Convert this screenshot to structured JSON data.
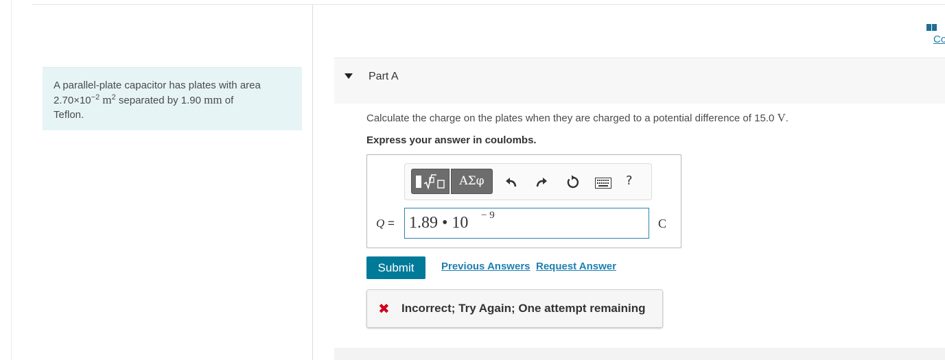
{
  "problem": {
    "line1": "A parallel-plate capacitor has plates with area",
    "area_value": "2.70×10",
    "area_exponent": "−2",
    "area_unit": "m",
    "area_unit_power": "2",
    "mid_text": " separated by 1.90 ",
    "separation_unit": "mm",
    "tail_text": " of",
    "line3": "Teflon."
  },
  "coaching": {
    "link_label": "Co",
    "icon": "book-icon"
  },
  "part": {
    "title": "Part A",
    "toggle_icon": "triangle-down-icon"
  },
  "question": {
    "text": "Calculate the charge on the plates when they are charged to a potential difference of 15.0 ",
    "unit": "V",
    "end": ".",
    "instruction": "Express your answer in coulombs."
  },
  "toolbar": {
    "greek_label": "ΑΣφ",
    "help_label": "?",
    "icons": [
      "templates-icon",
      "undo-icon",
      "redo-icon",
      "reset-icon",
      "keyboard-icon",
      "help-icon"
    ]
  },
  "answer": {
    "variable": "Q",
    "equals": " =",
    "value": "1.89 • 10",
    "exponent": "− 9",
    "unit": "C"
  },
  "actions": {
    "submit_label": "Submit",
    "previous_answers_label": "Previous Answers",
    "request_answer_label": "Request Answer"
  },
  "feedback": {
    "icon": "x-icon",
    "mark": "✖",
    "text": "Incorrect; Try Again; One attempt remaining"
  },
  "colors": {
    "accent": "#007a99",
    "link": "#1d7fb0",
    "error": "#d0021b",
    "problem_bg": "#e6f4f6"
  }
}
